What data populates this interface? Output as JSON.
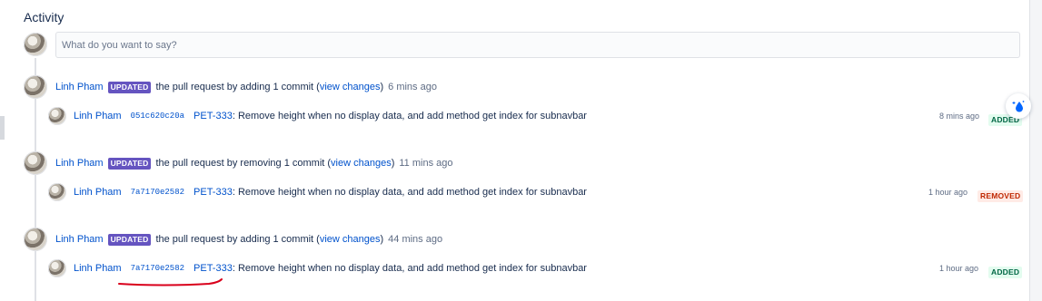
{
  "activity": {
    "title": "Activity",
    "comment_placeholder": "What do you want to say?"
  },
  "events": [
    {
      "author": "Linh Pham",
      "badge": "UPDATED",
      "action": "the pull request by adding 1 commit (",
      "view_changes": "view changes",
      "close_paren": ")",
      "time": "6 mins ago",
      "commit": {
        "author": "Linh Pham",
        "hash": "051c620c20a",
        "issue": "PET-333",
        "message": ": Remove height when no display data, and add method get index for subnavbar",
        "time": "8 mins ago",
        "status": "ADDED"
      }
    },
    {
      "author": "Linh Pham",
      "badge": "UPDATED",
      "action": "the pull request by removing 1 commit (",
      "view_changes": "view changes",
      "close_paren": ")",
      "time": "11 mins ago",
      "commit": {
        "author": "Linh Pham",
        "hash": "7a7170e2582",
        "issue": "PET-333",
        "message": ": Remove height when no display data, and add method get index for subnavbar",
        "time": "1 hour ago",
        "status": "REMOVED"
      }
    },
    {
      "author": "Linh Pham",
      "badge": "UPDATED",
      "action": "the pull request by adding 1 commit (",
      "view_changes": "view changes",
      "close_paren": ")",
      "time": "44 mins ago",
      "commit": {
        "author": "Linh Pham",
        "hash": "7a7170e2582",
        "issue": "PET-333",
        "message": ": Remove height when no display data, and add method get index for subnavbar",
        "time": "1 hour ago",
        "status": "ADDED"
      }
    }
  ],
  "colors": {
    "link": "#0052cc",
    "updated_badge": "#6554c0",
    "added_badge_text": "#006644",
    "removed_badge_text": "#bf2600",
    "annotation": "#d9001b"
  },
  "icons": {
    "floating_button": "water-drop-sparkle-icon"
  }
}
